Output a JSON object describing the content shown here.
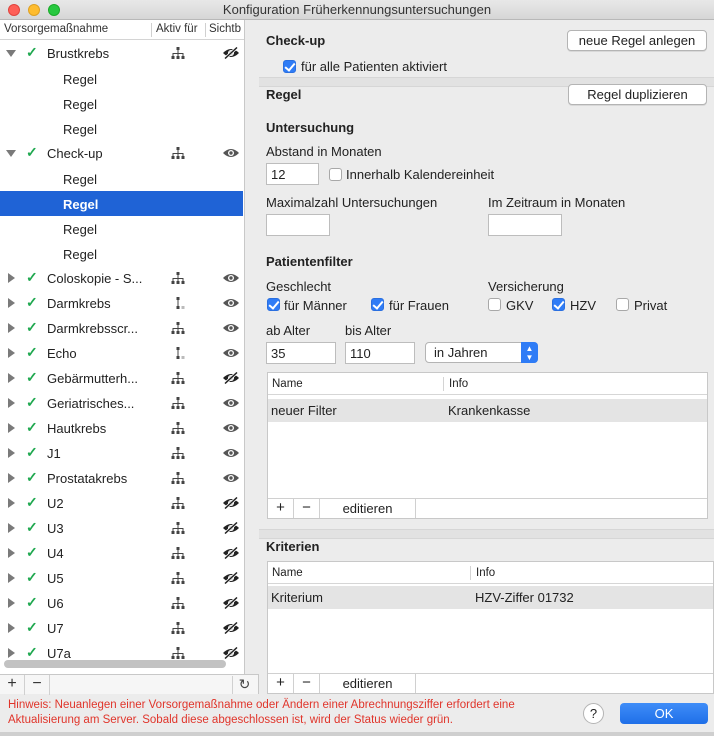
{
  "window": {
    "title": "Konfiguration Früherkennungsuntersuchungen"
  },
  "left_panel": {
    "columns": [
      "Vorsorgemaßnahme",
      "Aktiv für",
      "Sichtb"
    ],
    "items": [
      {
        "name": "Brustkrebs",
        "expanded": true,
        "checked": true,
        "eye": "hidden",
        "hier": "tree"
      },
      {
        "name": "Regel",
        "sub": true
      },
      {
        "name": "Regel",
        "sub": true
      },
      {
        "name": "Regel",
        "sub": true
      },
      {
        "name": "Check-up",
        "expanded": true,
        "checked": true,
        "eye": "visible",
        "hier": "tree"
      },
      {
        "name": "Regel",
        "sub": true
      },
      {
        "name": "Regel",
        "sub": true,
        "selected": true
      },
      {
        "name": "Regel",
        "sub": true
      },
      {
        "name": "Regel",
        "sub": true
      },
      {
        "name": "Coloskopie - S...",
        "checked": true,
        "eye": "visible",
        "hier": "tree"
      },
      {
        "name": "Darmkrebs",
        "checked": true,
        "eye": "visible",
        "hier": "single"
      },
      {
        "name": "Darmkrebsscr...",
        "checked": true,
        "eye": "visible",
        "hier": "tree"
      },
      {
        "name": "Echo",
        "checked": true,
        "eye": "visible",
        "hier": "single"
      },
      {
        "name": "Gebärmutterh...",
        "checked": true,
        "eye": "hidden",
        "hier": "tree"
      },
      {
        "name": "Geriatrisches...",
        "checked": true,
        "eye": "visible",
        "hier": "tree"
      },
      {
        "name": "Hautkrebs",
        "checked": true,
        "eye": "visible",
        "hier": "tree"
      },
      {
        "name": "J1",
        "checked": true,
        "eye": "visible",
        "hier": "tree"
      },
      {
        "name": "Prostatakrebs",
        "checked": true,
        "eye": "visible",
        "hier": "tree"
      },
      {
        "name": "U2",
        "checked": true,
        "eye": "hidden",
        "hier": "tree"
      },
      {
        "name": "U3",
        "checked": true,
        "eye": "hidden",
        "hier": "tree"
      },
      {
        "name": "U4",
        "checked": true,
        "eye": "hidden",
        "hier": "tree"
      },
      {
        "name": "U5",
        "checked": true,
        "eye": "hidden",
        "hier": "tree"
      },
      {
        "name": "U6",
        "checked": true,
        "eye": "hidden",
        "hier": "tree"
      },
      {
        "name": "U7",
        "checked": true,
        "eye": "hidden",
        "hier": "tree"
      },
      {
        "name": "U7a",
        "checked": true,
        "eye": "hidden",
        "hier": "tree"
      }
    ],
    "add_label": "+",
    "remove_label": "−",
    "refresh_label": "↻"
  },
  "checkup": {
    "title": "Check-up",
    "new_rule_button": "neue Regel anlegen",
    "all_patients_label": "für alle Patienten aktiviert",
    "all_patients_checked": true
  },
  "rule": {
    "title": "Regel",
    "duplicate_button": "Regel duplizieren"
  },
  "exam": {
    "title": "Untersuchung",
    "interval_label": "Abstand in Monaten",
    "interval_value": "12",
    "within_calendar_label": "Innerhalb Kalendereinheit",
    "within_calendar_checked": false,
    "max_count_label": "Maximalzahl Untersuchungen",
    "max_count_value": "",
    "period_label": "Im Zeitraum in Monaten",
    "period_value": ""
  },
  "patient_filter": {
    "title": "Patientenfilter",
    "gender_label": "Geschlecht",
    "male_label": "für Männer",
    "male_checked": true,
    "female_label": "für Frauen",
    "female_checked": true,
    "insurance_label": "Versicherung",
    "gkv_label": "GKV",
    "gkv_checked": false,
    "hzv_label": "HZV",
    "hzv_checked": true,
    "private_label": "Privat",
    "private_checked": false,
    "from_age_label": "ab Alter",
    "from_age_value": "35",
    "to_age_label": "bis Alter",
    "to_age_value": "110",
    "unit_select": "in Jahren",
    "table": {
      "columns": [
        "Name",
        "Info"
      ],
      "rows": [
        {
          "name": "neuer Filter",
          "info": "Krankenkasse"
        }
      ]
    },
    "add_label": "+",
    "remove_label": "−",
    "edit_label": "editieren"
  },
  "criteria": {
    "title": "Kriterien",
    "table": {
      "columns": [
        "Name",
        "Info"
      ],
      "rows": [
        {
          "name": "Kriterium",
          "info": "HZV-Ziffer 01732"
        }
      ]
    },
    "add_label": "+",
    "remove_label": "−",
    "edit_label": "editieren"
  },
  "footer": {
    "hint": "Hinweis: Neuanlegen einer Vorsorgemaßnahme oder Ändern einer Abrechnungsziffer erfordert eine Aktualisierung am Server. Sobald diese abgeschlossen ist, wird der Status wieder grün.",
    "help_label": "?",
    "ok_label": "OK"
  }
}
